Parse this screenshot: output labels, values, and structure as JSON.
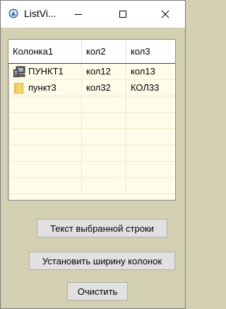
{
  "window": {
    "title": "ListVi...",
    "controls": {
      "minimize": "minimize-icon",
      "maximize": "maximize-icon",
      "close": "close-icon"
    }
  },
  "listview": {
    "columns": [
      "Колонка1",
      "кол2",
      "кол3"
    ],
    "rows": [
      {
        "icon": "computer-icon",
        "cells": [
          "ПУНКТ1",
          "кол12",
          "кол13"
        ]
      },
      {
        "icon": "folder-icon",
        "cells": [
          "пункт3",
          "кол32",
          "КОЛ33"
        ]
      }
    ],
    "header_separator_color": "#d60000",
    "background_color": "#fffdea"
  },
  "buttons": {
    "selected_text": "Текст выбранной строки",
    "set_width": "Установить ширину колонок",
    "clear": "Очистить"
  }
}
